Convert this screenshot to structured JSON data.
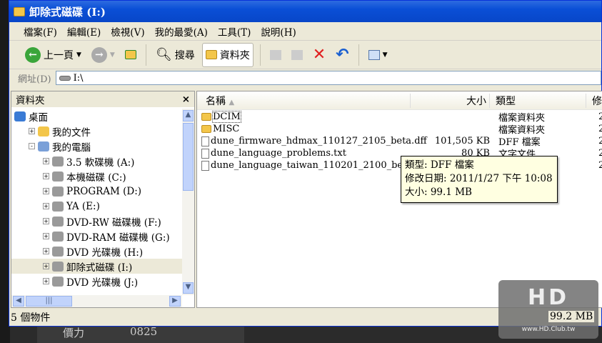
{
  "window": {
    "title": "卸除式磁碟 (I:)"
  },
  "menu": [
    "檔案(F)",
    "編輯(E)",
    "檢視(V)",
    "我的最愛(A)",
    "工具(T)",
    "說明(H)"
  ],
  "toolbar": {
    "back": "上一頁",
    "search": "搜尋",
    "folders": "資料夾"
  },
  "address": {
    "label": "網址(D)",
    "value": "I:\\"
  },
  "left_pane": {
    "title": "資料夾",
    "close": "×",
    "items": [
      {
        "label": "桌面",
        "level": 0,
        "exp": ""
      },
      {
        "label": "我的文件",
        "level": 1,
        "exp": "+"
      },
      {
        "label": "我的電腦",
        "level": 1,
        "exp": "-"
      },
      {
        "label": "3.5 軟碟機 (A:)",
        "level": 2,
        "exp": "+"
      },
      {
        "label": "本機磁碟 (C:)",
        "level": 2,
        "exp": "+"
      },
      {
        "label": "PROGRAM (D:)",
        "level": 2,
        "exp": "+"
      },
      {
        "label": "YA (E:)",
        "level": 2,
        "exp": "+"
      },
      {
        "label": "DVD-RW 磁碟機 (F:)",
        "level": 2,
        "exp": "+"
      },
      {
        "label": "DVD-RAM 磁碟機 (G:)",
        "level": 2,
        "exp": "+"
      },
      {
        "label": "DVD 光碟機 (H:)",
        "level": 2,
        "exp": "+"
      },
      {
        "label": "卸除式磁碟 (I:)",
        "level": 2,
        "exp": "+"
      },
      {
        "label": "DVD 光碟機 (J:)",
        "level": 2,
        "exp": "+"
      }
    ]
  },
  "columns": {
    "name": "名稱",
    "size": "大小",
    "type": "類型",
    "date": "修"
  },
  "files": [
    {
      "name": "DCIM",
      "size": "",
      "type": "檔案資料夾",
      "date": "2",
      "kind": "folder"
    },
    {
      "name": "MISC",
      "size": "",
      "type": "檔案資料夾",
      "date": "2",
      "kind": "folder"
    },
    {
      "name": "dune_firmware_hdmax_110127_2105_beta.dff",
      "size": "101,505 KB",
      "type": "DFF 檔案",
      "date": "2",
      "kind": "dff"
    },
    {
      "name": "dune_language_problems.txt",
      "size": "80 KB",
      "type": "文字文件",
      "date": "2",
      "kind": "txt"
    },
    {
      "name": "dune_language_taiwan_110201_2100_beta.txt",
      "size": "",
      "type": "",
      "date": "2",
      "kind": "txt"
    }
  ],
  "tooltip": {
    "type": "類型: DFF 檔案",
    "modified": "修改日期: 2011/1/27 下午 10:08",
    "size": "大小: 99.1 MB"
  },
  "status": {
    "count": "5 個物件",
    "size": "99.2 MB"
  },
  "watermark": {
    "brand": "HD CLUB",
    "url": "www.HD.Club.tw"
  },
  "background": {
    "text1": "價力",
    "text2": "0825"
  }
}
